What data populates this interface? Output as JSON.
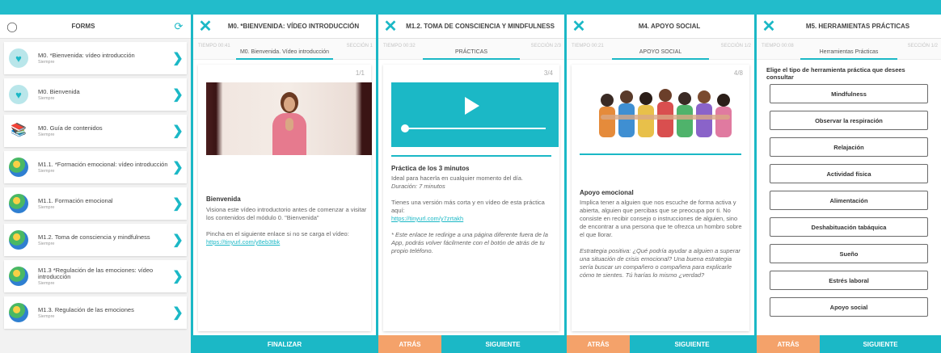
{
  "panel1": {
    "title": "FORMS",
    "items": [
      {
        "name": "M0. *Bienvenida: vídeo introducción",
        "sub": "Siempre",
        "icon": "heart-icon"
      },
      {
        "name": "M0. Bienvenida",
        "sub": "Siempre",
        "icon": "heart-icon"
      },
      {
        "name": "M0. Guía de contenidos",
        "sub": "Siempre",
        "icon": "books-icon"
      },
      {
        "name": "M1.1. *Formación emocional: vídeo introducción",
        "sub": "Siempre",
        "icon": "globe-icon"
      },
      {
        "name": "M1.1. Formación emocional",
        "sub": "Siempre",
        "icon": "globe-icon"
      },
      {
        "name": "M1.2. Toma de consciencia y mindfulness",
        "sub": "Siempre",
        "icon": "globe-icon"
      },
      {
        "name": "M1.3 *Regulación de las emociones: vídeo introducción",
        "sub": "Siempre",
        "icon": "globe-icon"
      },
      {
        "name": "M1.3. Regulación de las emociones",
        "sub": "Siempre",
        "icon": "globe-icon"
      }
    ]
  },
  "panel2": {
    "title": "M0. *BIENVENIDA: VÍDEO INTRODUCCIÓN",
    "time": "TIEMPO 00:41",
    "section": "SECCIÓN 1",
    "tab": "M0. Bienvenida. Vídeo introducción",
    "page": "1/1",
    "heading": "Bienvenida",
    "p1": "Visiona este vídeo introductorio antes de comenzar a visitar los contenidos del módulo 0. \"Bienvenida\"",
    "p2": "Pincha en el siguiente enlace si no se carga el vídeo:",
    "link": "https://tinyurl.com/y8eb3tbk",
    "footer": "FINALIZAR"
  },
  "panel3": {
    "title": "M1.2. TOMA DE CONSCIENCIA Y MINDFULNESS",
    "time": "TIEMPO 00:32",
    "section": "SECCIÓN 2/3",
    "tab": "PRÁCTICAS",
    "page": "3/4",
    "heading": "Práctica de los 3 minutos",
    "p1": "Ideal para hacerla en cualquier momento del día.",
    "duration": "Duración: 7 minutos",
    "p2": "Tienes una versión más corta y en vídeo de esta práctica aquí:",
    "link": "https://tinyurl.com/y7zrtakh",
    "note": "* Este enlace te redirige a una página diferente fuera de la App, podrás volver fácilmente con el botón de atrás de tu propio teléfono.",
    "back": "ATRÁS",
    "next": "SIGUIENTE"
  },
  "panel4": {
    "title": "M4. APOYO SOCIAL",
    "time": "TIEMPO 00:21",
    "section": "SECCIÓN 1/2",
    "tab": "APOYO SOCIAL",
    "page": "4/8",
    "heading": "Apoyo emocional",
    "p1": "Implica tener a alguien que nos escuche de forma activa y abierta, alguien que percibas que se preocupa por ti. No consiste en recibir consejo o instrucciones de alguien, sino de encontrar a una persona que te ofrezca un hombro sobre el que llorar.",
    "p2": "Estrategia positiva: ¿Qué podría ayudar a alguien a superar una situación de crisis emocional? Una buena estrategia sería buscar un compañero o compañera para explicarle cómo te sientes. Tú harías lo mismo ¿verdad?",
    "back": "ATRÁS",
    "next": "SIGUIENTE"
  },
  "panel5": {
    "title": "M5. HERRAMIENTAS PRÁCTICAS",
    "time": "TIEMPO 00:08",
    "section": "SECCIÓN 1/2",
    "tab": "Herramientas Prácticas",
    "question": "Elige el tipo de herramienta práctica que desees consultar",
    "options": [
      "Mindfulness",
      "Observar la respiración",
      "Relajación",
      "Actividad física",
      "Alimentación",
      "Deshabituación tabáquica",
      "Sueño",
      "Estrés laboral",
      "Apoyo social"
    ],
    "back": "ATRÁS",
    "next": "SIGUIENTE"
  },
  "colors": {
    "accent": "#1bb8c6",
    "back_button": "#f4a26a"
  }
}
